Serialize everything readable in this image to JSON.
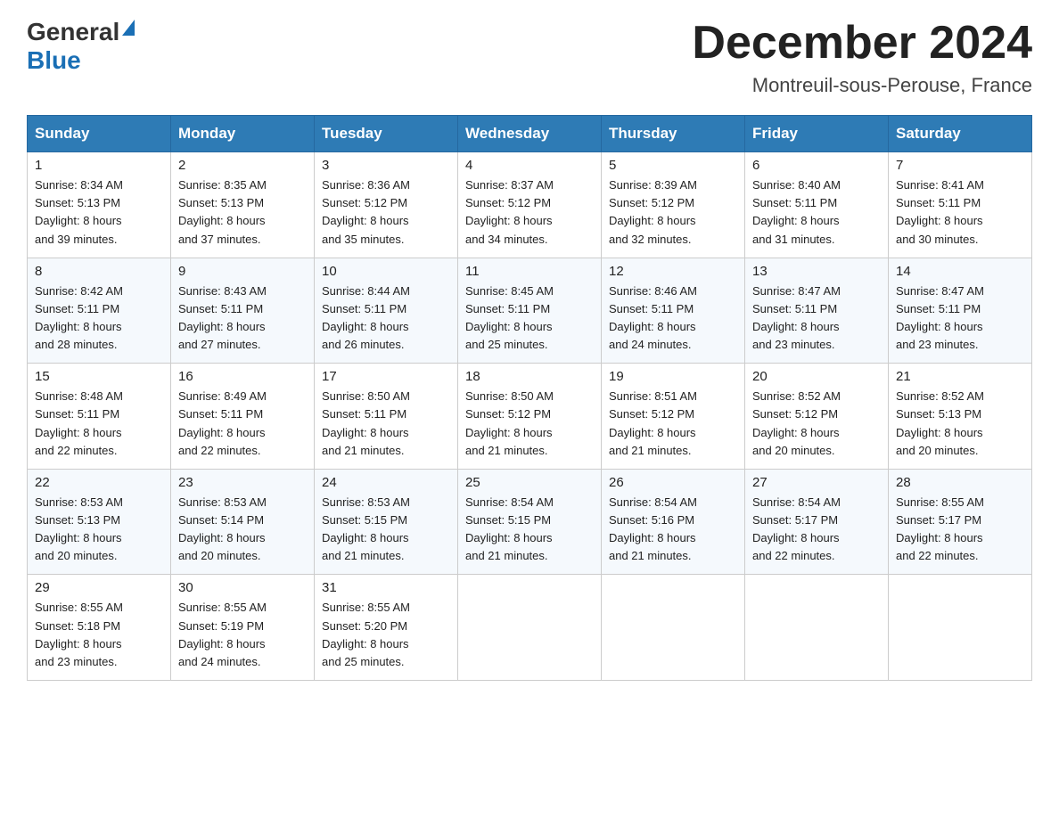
{
  "header": {
    "logo_general": "General",
    "logo_blue": "Blue",
    "month_title": "December 2024",
    "location": "Montreuil-sous-Perouse, France"
  },
  "weekdays": [
    "Sunday",
    "Monday",
    "Tuesday",
    "Wednesday",
    "Thursday",
    "Friday",
    "Saturday"
  ],
  "weeks": [
    [
      {
        "day": "1",
        "sunrise": "8:34 AM",
        "sunset": "5:13 PM",
        "daylight": "8 hours and 39 minutes."
      },
      {
        "day": "2",
        "sunrise": "8:35 AM",
        "sunset": "5:13 PM",
        "daylight": "8 hours and 37 minutes."
      },
      {
        "day": "3",
        "sunrise": "8:36 AM",
        "sunset": "5:12 PM",
        "daylight": "8 hours and 35 minutes."
      },
      {
        "day": "4",
        "sunrise": "8:37 AM",
        "sunset": "5:12 PM",
        "daylight": "8 hours and 34 minutes."
      },
      {
        "day": "5",
        "sunrise": "8:39 AM",
        "sunset": "5:12 PM",
        "daylight": "8 hours and 32 minutes."
      },
      {
        "day": "6",
        "sunrise": "8:40 AM",
        "sunset": "5:11 PM",
        "daylight": "8 hours and 31 minutes."
      },
      {
        "day": "7",
        "sunrise": "8:41 AM",
        "sunset": "5:11 PM",
        "daylight": "8 hours and 30 minutes."
      }
    ],
    [
      {
        "day": "8",
        "sunrise": "8:42 AM",
        "sunset": "5:11 PM",
        "daylight": "8 hours and 28 minutes."
      },
      {
        "day": "9",
        "sunrise": "8:43 AM",
        "sunset": "5:11 PM",
        "daylight": "8 hours and 27 minutes."
      },
      {
        "day": "10",
        "sunrise": "8:44 AM",
        "sunset": "5:11 PM",
        "daylight": "8 hours and 26 minutes."
      },
      {
        "day": "11",
        "sunrise": "8:45 AM",
        "sunset": "5:11 PM",
        "daylight": "8 hours and 25 minutes."
      },
      {
        "day": "12",
        "sunrise": "8:46 AM",
        "sunset": "5:11 PM",
        "daylight": "8 hours and 24 minutes."
      },
      {
        "day": "13",
        "sunrise": "8:47 AM",
        "sunset": "5:11 PM",
        "daylight": "8 hours and 23 minutes."
      },
      {
        "day": "14",
        "sunrise": "8:47 AM",
        "sunset": "5:11 PM",
        "daylight": "8 hours and 23 minutes."
      }
    ],
    [
      {
        "day": "15",
        "sunrise": "8:48 AM",
        "sunset": "5:11 PM",
        "daylight": "8 hours and 22 minutes."
      },
      {
        "day": "16",
        "sunrise": "8:49 AM",
        "sunset": "5:11 PM",
        "daylight": "8 hours and 22 minutes."
      },
      {
        "day": "17",
        "sunrise": "8:50 AM",
        "sunset": "5:11 PM",
        "daylight": "8 hours and 21 minutes."
      },
      {
        "day": "18",
        "sunrise": "8:50 AM",
        "sunset": "5:12 PM",
        "daylight": "8 hours and 21 minutes."
      },
      {
        "day": "19",
        "sunrise": "8:51 AM",
        "sunset": "5:12 PM",
        "daylight": "8 hours and 21 minutes."
      },
      {
        "day": "20",
        "sunrise": "8:52 AM",
        "sunset": "5:12 PM",
        "daylight": "8 hours and 20 minutes."
      },
      {
        "day": "21",
        "sunrise": "8:52 AM",
        "sunset": "5:13 PM",
        "daylight": "8 hours and 20 minutes."
      }
    ],
    [
      {
        "day": "22",
        "sunrise": "8:53 AM",
        "sunset": "5:13 PM",
        "daylight": "8 hours and 20 minutes."
      },
      {
        "day": "23",
        "sunrise": "8:53 AM",
        "sunset": "5:14 PM",
        "daylight": "8 hours and 20 minutes."
      },
      {
        "day": "24",
        "sunrise": "8:53 AM",
        "sunset": "5:15 PM",
        "daylight": "8 hours and 21 minutes."
      },
      {
        "day": "25",
        "sunrise": "8:54 AM",
        "sunset": "5:15 PM",
        "daylight": "8 hours and 21 minutes."
      },
      {
        "day": "26",
        "sunrise": "8:54 AM",
        "sunset": "5:16 PM",
        "daylight": "8 hours and 21 minutes."
      },
      {
        "day": "27",
        "sunrise": "8:54 AM",
        "sunset": "5:17 PM",
        "daylight": "8 hours and 22 minutes."
      },
      {
        "day": "28",
        "sunrise": "8:55 AM",
        "sunset": "5:17 PM",
        "daylight": "8 hours and 22 minutes."
      }
    ],
    [
      {
        "day": "29",
        "sunrise": "8:55 AM",
        "sunset": "5:18 PM",
        "daylight": "8 hours and 23 minutes."
      },
      {
        "day": "30",
        "sunrise": "8:55 AM",
        "sunset": "5:19 PM",
        "daylight": "8 hours and 24 minutes."
      },
      {
        "day": "31",
        "sunrise": "8:55 AM",
        "sunset": "5:20 PM",
        "daylight": "8 hours and 25 minutes."
      },
      null,
      null,
      null,
      null
    ]
  ],
  "labels": {
    "sunrise": "Sunrise:",
    "sunset": "Sunset:",
    "daylight": "Daylight:"
  }
}
